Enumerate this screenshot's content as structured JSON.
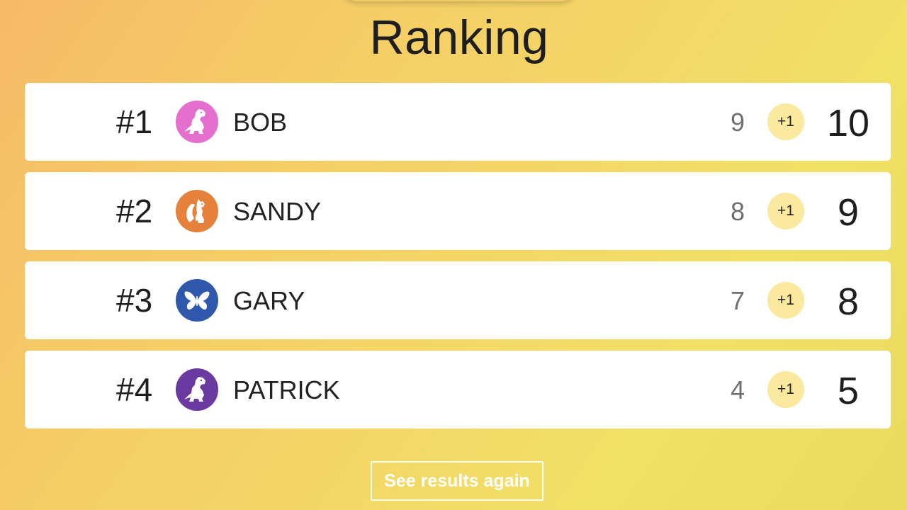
{
  "title": "Ranking",
  "players": [
    {
      "rank": "#1",
      "name": "BOB",
      "previous": "9",
      "bonus": "+1",
      "total": "10",
      "avatar_icon": "dinosaur-icon",
      "avatar_color": "#e46fcf"
    },
    {
      "rank": "#2",
      "name": "SANDY",
      "previous": "8",
      "bonus": "+1",
      "total": "9",
      "avatar_icon": "squirrel-icon",
      "avatar_color": "#e5813b"
    },
    {
      "rank": "#3",
      "name": "GARY",
      "previous": "7",
      "bonus": "+1",
      "total": "8",
      "avatar_icon": "butterfly-icon",
      "avatar_color": "#2f58ad"
    },
    {
      "rank": "#4",
      "name": "PATRICK",
      "previous": "4",
      "bonus": "+1",
      "total": "5",
      "avatar_icon": "dinosaur-icon",
      "avatar_color": "#6a3aa0"
    }
  ],
  "see_results_button": "See results again",
  "colors": {
    "bonus_badge": "#fbe9a0",
    "row_background": "#ffffff"
  }
}
